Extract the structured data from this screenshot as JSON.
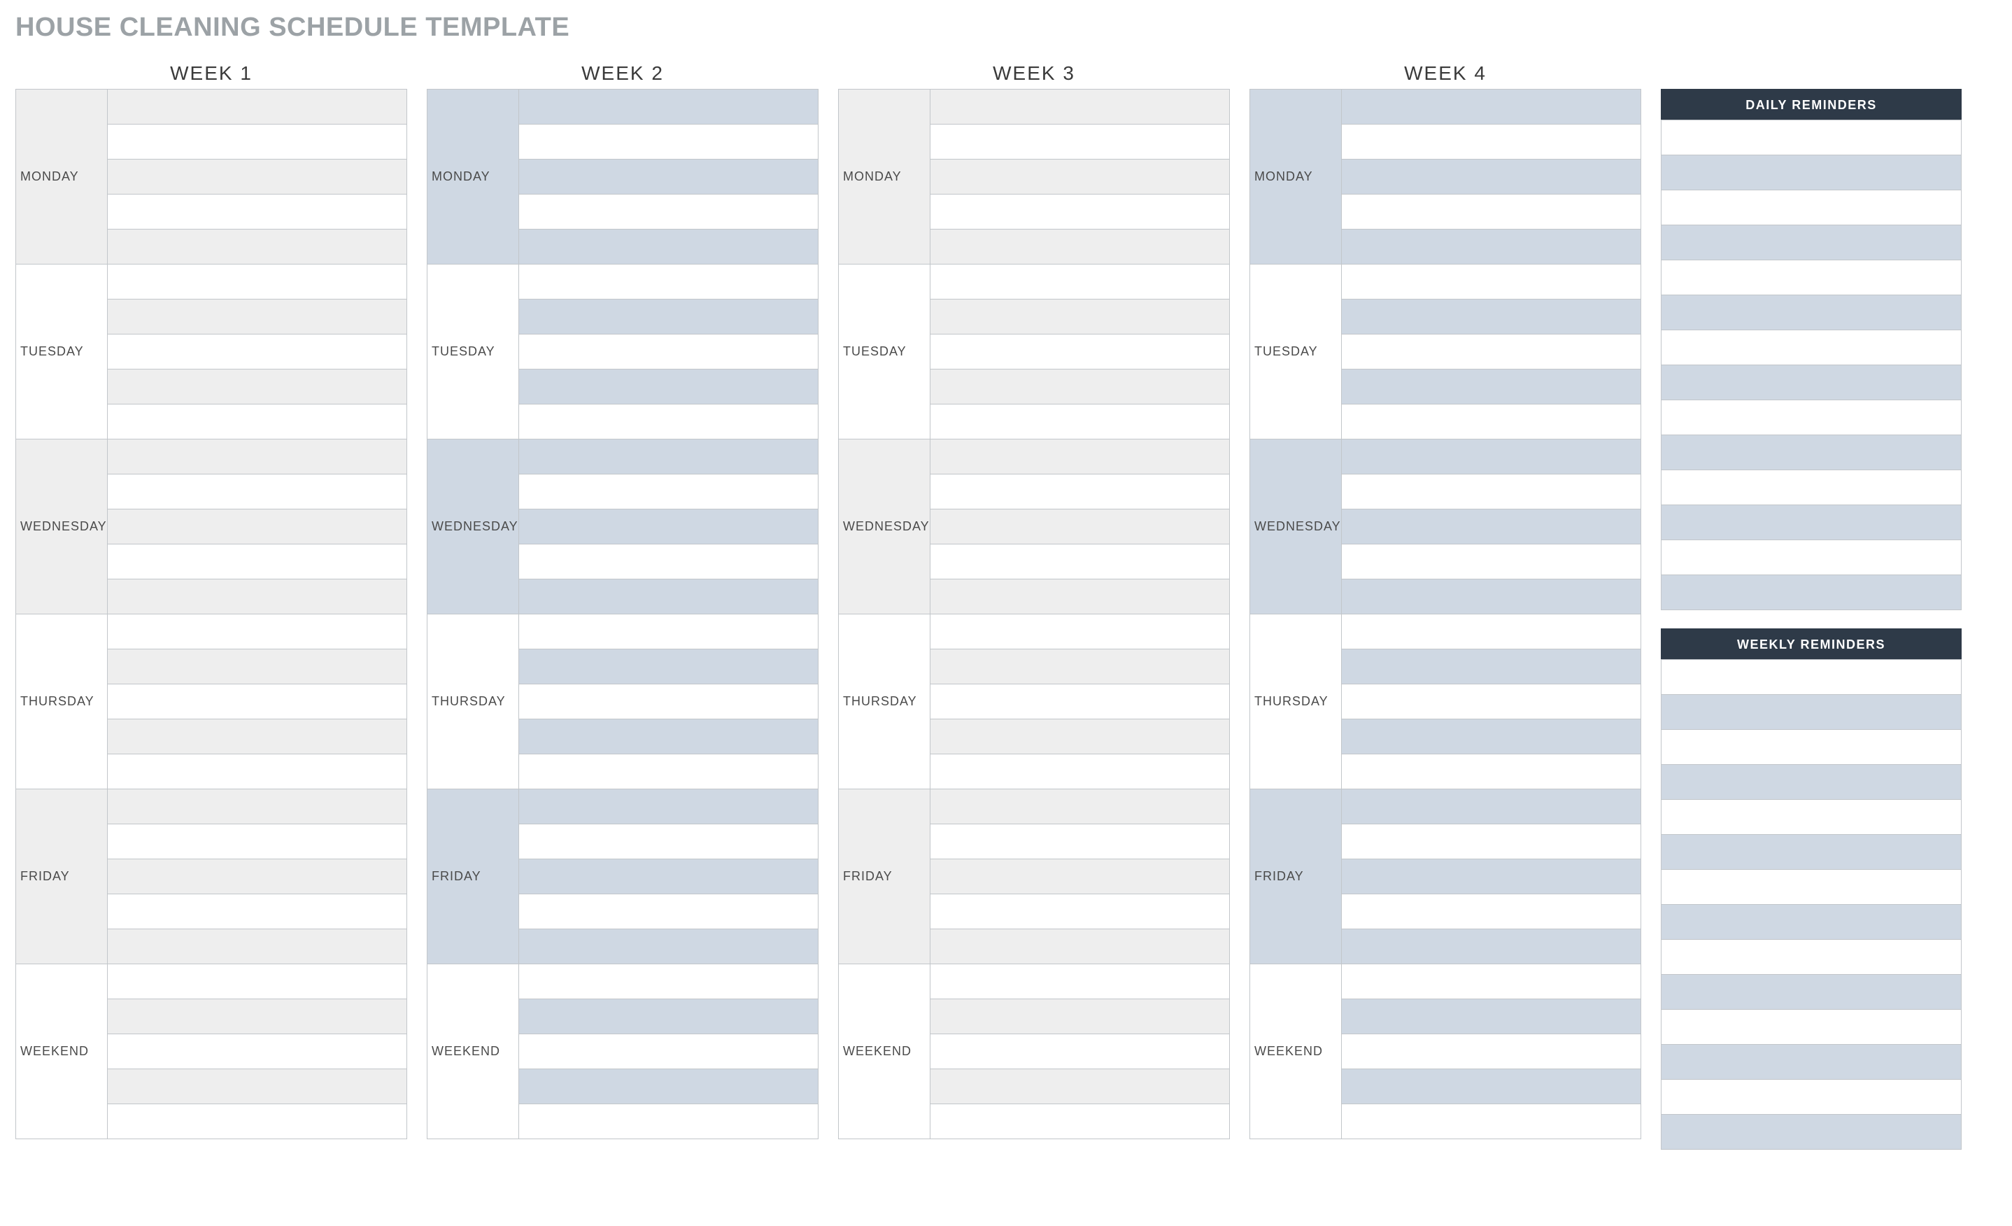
{
  "title": "HOUSE CLEANING SCHEDULE TEMPLATE",
  "weeks": [
    {
      "label": "WEEK 1"
    },
    {
      "label": "WEEK 2"
    },
    {
      "label": "WEEK 3"
    },
    {
      "label": "WEEK 4"
    }
  ],
  "days": [
    {
      "label": "MONDAY",
      "tone": "shaded"
    },
    {
      "label": "TUESDAY",
      "tone": "plain"
    },
    {
      "label": "WEDNESDAY",
      "tone": "shaded"
    },
    {
      "label": "THURSDAY",
      "tone": "plain"
    },
    {
      "label": "FRIDAY",
      "tone": "shaded"
    },
    {
      "label": "WEEKEND",
      "tone": "plain"
    }
  ],
  "tasks_per_day": 5,
  "reminders": {
    "daily": {
      "header": "DAILY REMINDERS",
      "rows": 14
    },
    "weekly": {
      "header": "WEEKLY REMINDERS",
      "rows": 14
    }
  },
  "palette": {
    "odd_week_shade": "gray",
    "even_week_shade": "blue"
  }
}
